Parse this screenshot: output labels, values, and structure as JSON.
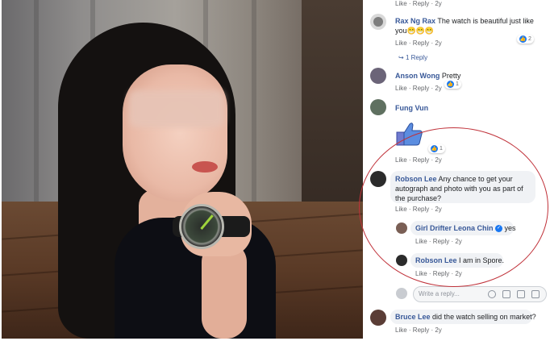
{
  "comments": {
    "top_actions": "Like · Reply · 2y",
    "c1": {
      "author": "Rax Ng Rax",
      "text": "The watch is beautiful just like you😁😁😁",
      "actions": "Like · Reply · 2y",
      "reactions": "2",
      "replies_link": "1 Reply"
    },
    "c2": {
      "author": "Anson Wong",
      "text": "Pretty",
      "actions": "Like · Reply · 2y",
      "reactions": "1"
    },
    "c3": {
      "author": "Fung Vun",
      "actions": "Like · Reply · 2y",
      "reactions": "1"
    },
    "c4": {
      "author": "Robson Lee",
      "text": "Any chance to get your autograph and photo with you as part of the purchase?",
      "actions": "Like · Reply · 2y"
    },
    "r1": {
      "author": "Girl Drifter Leona Chin",
      "text": "yes",
      "actions": "Like · Reply · 2y"
    },
    "r2": {
      "author": "Robson Lee",
      "text": "I am in Spore.",
      "actions": "Like · Reply · 2y"
    },
    "write_reply_placeholder": "Write a reply...",
    "c5": {
      "author": "Bruce Lee",
      "text": "did the watch selling on market?",
      "actions": "Like · Reply · 2y"
    }
  },
  "colors": {
    "link_blue": "#385898",
    "like_blue": "#1877f2",
    "annotation_red": "#c0323a"
  },
  "icons": [
    "thumbs-up-sticker-icon",
    "smiley-icon",
    "camera-icon",
    "gif-icon",
    "sticker-icon"
  ]
}
